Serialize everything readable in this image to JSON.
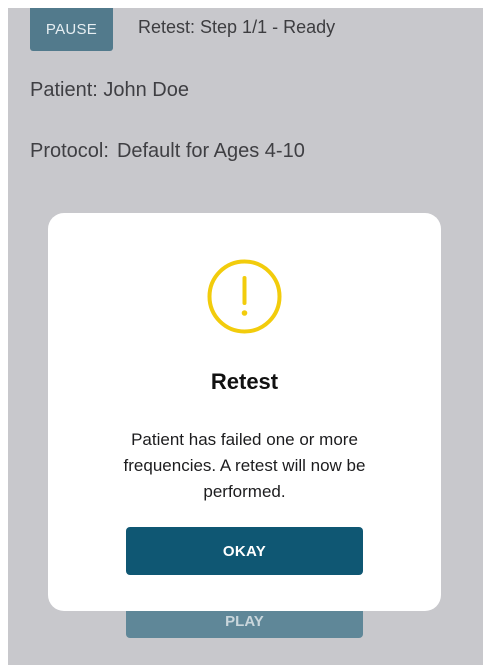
{
  "header": {
    "pause_label": "PAUSE",
    "status": "Retest: Step 1/1 - Ready"
  },
  "info": {
    "patient": "Patient: John Doe",
    "protocol_label": "Protocol:",
    "protocol_value": "Default for Ages 4-10"
  },
  "footer": {
    "play_label": "PLAY"
  },
  "dialog": {
    "icon": "warning-circle-icon",
    "title": "Retest",
    "message": "Patient has failed one or more frequencies. A retest will now be performed.",
    "okay_label": "OKAY"
  },
  "colors": {
    "overlay_background": "#c8c8cc",
    "pause_button": "#527a8c",
    "okay_button": "#0f5773",
    "warning_icon": "#f2cc0c"
  }
}
